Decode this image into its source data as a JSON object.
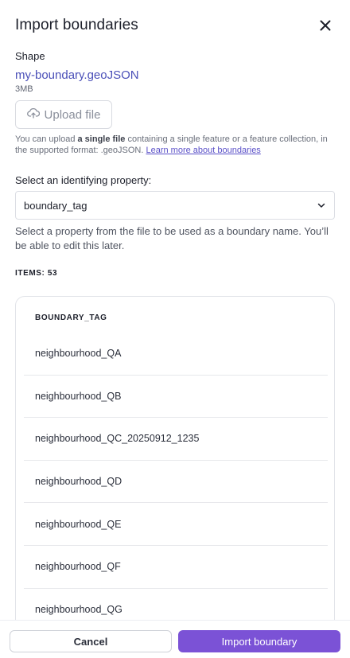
{
  "dialog": {
    "title": "Import boundaries"
  },
  "shape": {
    "label": "Shape",
    "file_name": "my-boundary.geoJSON",
    "file_size": "3MB",
    "upload_label": "Upload file",
    "help_prefix": "You can upload ",
    "help_bold": "a single file",
    "help_suffix": " containing a single feature or a feature collection, in the supported format: .geoJSON. ",
    "help_link": "Learn more about boundaries"
  },
  "property": {
    "label": "Select an identifying property:",
    "selected": "boundary_tag",
    "help": "Select a property from the file to be used as a boundary name. You’ll be able to edit this later."
  },
  "items": {
    "count_label": "ITEMS: 53",
    "column_header": "BOUNDARY_TAG",
    "rows": [
      "neighbourhood_QA",
      "neighbourhood_QB",
      "neighbourhood_QC_20250912_1235",
      "neighbourhood_QD",
      "neighbourhood_QE",
      "neighbourhood_QF",
      "neighbourhood_QG"
    ]
  },
  "footer": {
    "cancel_label": "Cancel",
    "import_label": "Import boundary"
  },
  "colors": {
    "primary": "#7b52d6",
    "link": "#4a4fb8"
  }
}
